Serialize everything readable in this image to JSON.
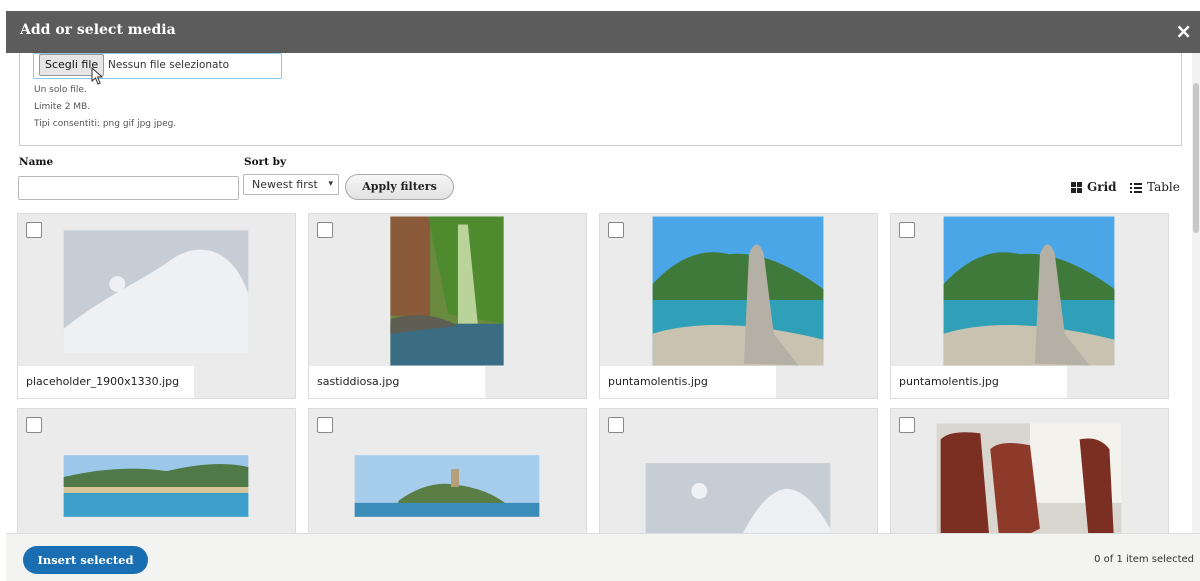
{
  "dialog": {
    "title": "Add or select media",
    "close_glyph": "×"
  },
  "upload": {
    "choose_button": "Scegli file",
    "status": "Nessun file selezionato",
    "hints": [
      "Un solo file.",
      "Limite 2 MB.",
      "Tipi consentiti: png gif jpg jpeg."
    ]
  },
  "filters": {
    "name_label": "Name",
    "name_value": "",
    "sort_label": "Sort by",
    "sort_selected": "Newest first",
    "apply_label": "Apply filters"
  },
  "view": {
    "grid_label": "Grid",
    "table_label": "Table"
  },
  "media": [
    {
      "filename": "placeholder_1900x1330.jpg",
      "thumb": "placeholder-icon",
      "checked": false
    },
    {
      "filename": "sastiddiosa.jpg",
      "thumb": "waterfall-photo",
      "checked": false
    },
    {
      "filename": "puntamolentis.jpg",
      "thumb": "rock-coast-photo",
      "checked": false
    },
    {
      "filename": "puntamolentis.jpg",
      "thumb": "rock-coast-photo",
      "checked": false
    },
    {
      "filename": "",
      "thumb": "beach-panorama-photo",
      "checked": false
    },
    {
      "filename": "",
      "thumb": "tower-island-photo",
      "checked": false
    },
    {
      "filename": "",
      "thumb": "placeholder-icon",
      "checked": false
    },
    {
      "filename": "",
      "thumb": "train-seats-photo",
      "checked": false
    }
  ],
  "footer": {
    "insert_label": "Insert selected",
    "selected_count": "0 of 1 item selected"
  },
  "colors": {
    "titlebar": "#5c5c5c",
    "primary_button": "#1a6fb3",
    "card_bg": "#ebebeb"
  }
}
